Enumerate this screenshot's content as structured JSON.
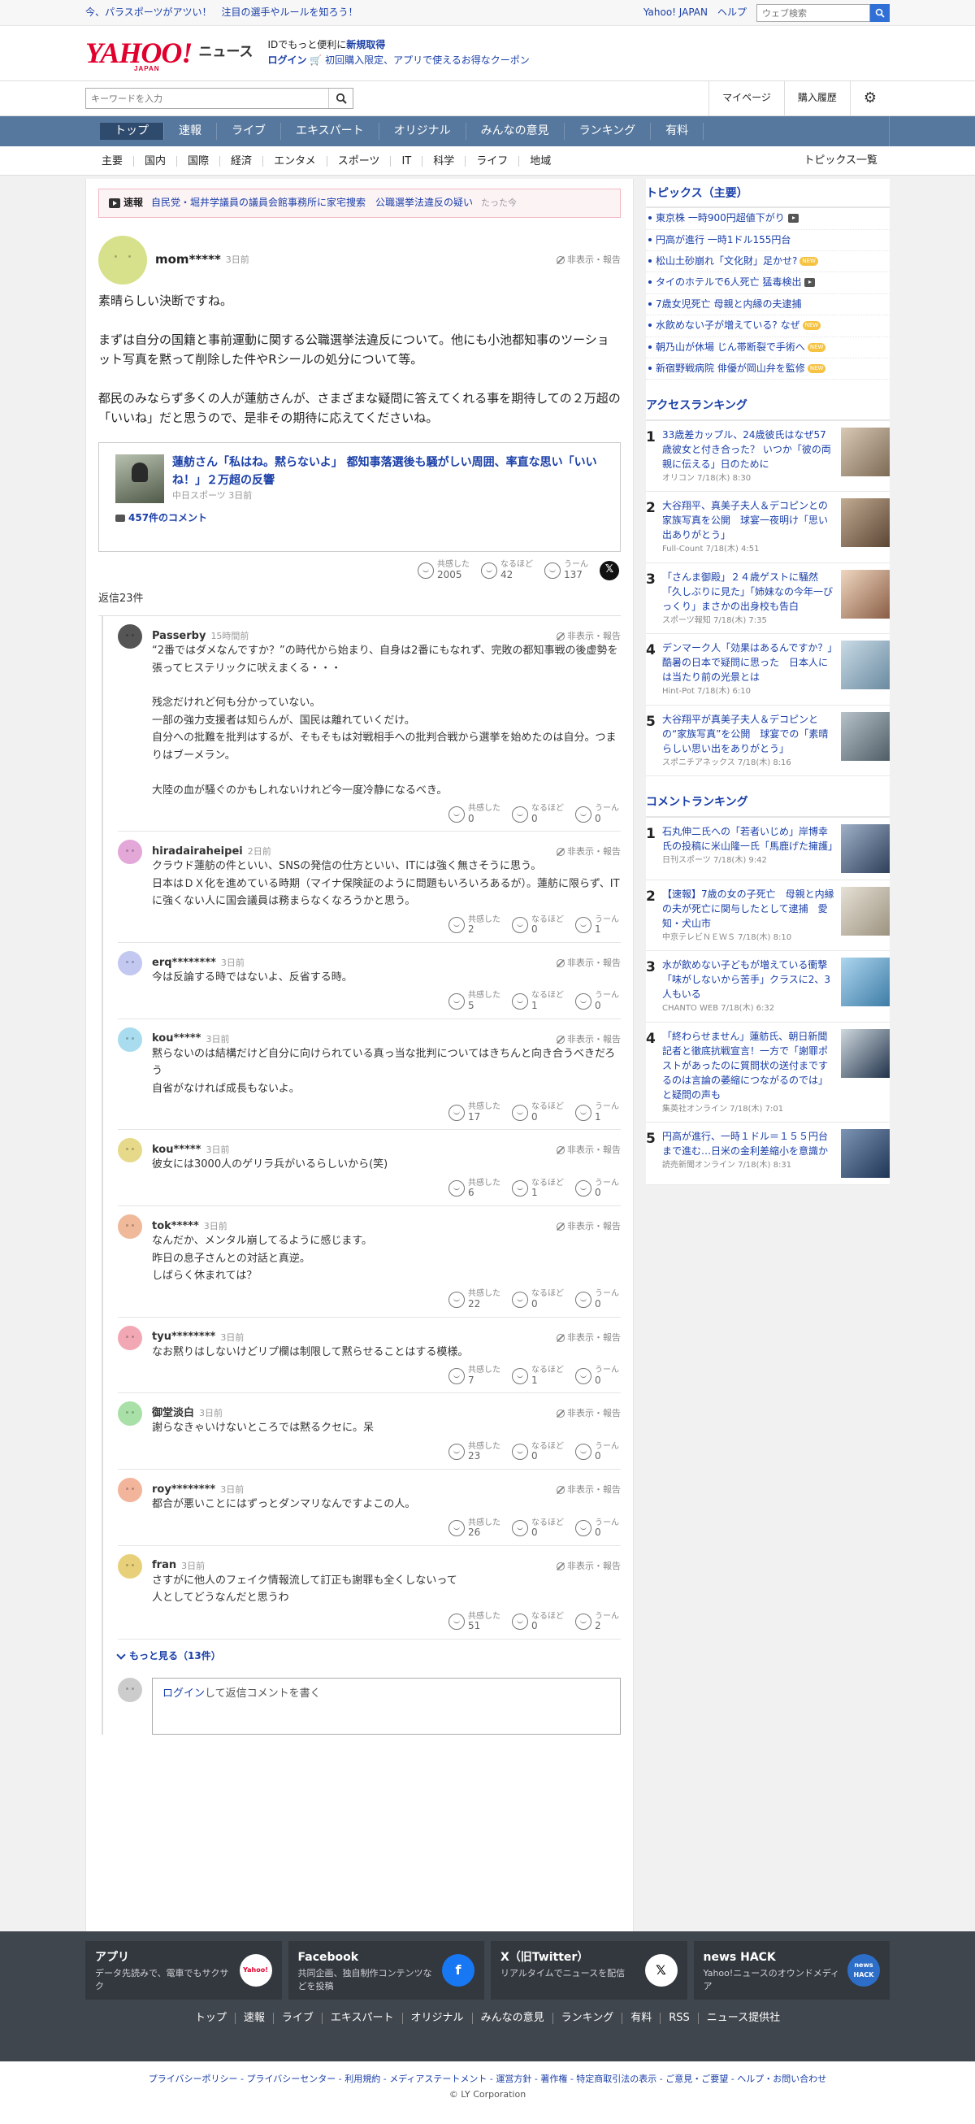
{
  "topbar": {
    "promo": "今、パラスポーツがアツい！　注目の選手やルールを知ろう！",
    "yj": "Yahoo! JAPAN",
    "help": "ヘルプ",
    "web_search_placeholder": "ウェブ検索"
  },
  "header": {
    "logo": "YAHOO!",
    "logo_sub": "JAPAN",
    "news": "ニュース",
    "id_line_1": "IDでもっと便利に",
    "id_line_1b": "新規取得",
    "login": "ログイン",
    "coupon": "初回購入限定、アプリで使えるお得なクーポン"
  },
  "search": {
    "placeholder": "キーワードを入力",
    "mypage": "マイページ",
    "history": "購入履歴"
  },
  "gnav": [
    "トップ",
    "速報",
    "ライブ",
    "エキスパート",
    "オリジナル",
    "みんなの意見",
    "ランキング",
    "有料"
  ],
  "snav": [
    "主要",
    "国内",
    "国際",
    "経済",
    "エンタメ",
    "スポーツ",
    "IT",
    "科学",
    "ライフ",
    "地域"
  ],
  "snav_all": "トピックス一覧",
  "breaking": {
    "tag": "速報",
    "text": "自民党・堀井学議員の議員会館事務所に家宅捜索　公職選挙法違反の疑い",
    "time": "たった今"
  },
  "post": {
    "user": "mom*****",
    "ago": "3日前",
    "hide": "非表示・報告",
    "text": "素晴らしい決断ですね。\n\nまずは自分の国籍と事前運動に関する公職選挙法違反について。他にも小池都知事のツーショット写真を黙って削除した件やRシールの処分について等。\n\n都民のみならず多くの人が蓮舫さんが、さまざまな疑問に答えてくれる事を期待しての２万超の「いいね」だと思うので、是非その期待に応えてくださいね。",
    "article_title": "蓮舫さん「私はね。黙らないよ」 都知事落選後も騒がしい周囲、率直な思い「いいね！」２万超の反響",
    "article_src": "中日スポーツ 3日前",
    "article_comments": "457件のコメント",
    "react": {
      "l1": "共感した",
      "n1": "2005",
      "l2": "なるほど",
      "n2": "42",
      "l3": "うーん",
      "n3": "137"
    },
    "x": "𝕏"
  },
  "replies_header": "返信23件",
  "replies": [
    {
      "name": "Passerby",
      "ago": "15時間前",
      "color": "#555555",
      "text": "“2番ではダメなんですか？”の時代から始まり、自身は2番にもなれず、完敗の都知事戦の後虚勢を張ってヒステリックに吠えまくる・・・\n\n残念だけれど何も分かっていない。\n一部の強力支援者は知らんが、国民は離れていくだけ。\n自分への批難を批判はするが、そもそもは対戦相手への批判合戦から選挙を始めたのは自分。つまりはブーメラン。\n\n大陸の血が騒ぐのかもしれないけれど今一度冷静になるべき。",
      "n1": "0",
      "n2": "0",
      "n3": "0"
    },
    {
      "name": "hiradairaheipei",
      "ago": "2日前",
      "color": "#e3a8d8",
      "text": "クラウド蓮舫の件といい、SNSの発信の仕方といい、ITには強く無さそうに思う。\n日本はＤＸ化を進めている時期（マイナ保険証のように問題もいろいろあるが）。蓮舫に限らず、ITに強くない人に国会議員は務まらなくなろうかと思う。",
      "n1": "2",
      "n2": "0",
      "n3": "1"
    },
    {
      "name": "erq********",
      "ago": "3日前",
      "color": "#c2c8f0",
      "text": "今は反論する時ではないよ、反省する時。",
      "n1": "5",
      "n2": "1",
      "n3": "0"
    },
    {
      "name": "kou*****",
      "ago": "3日前",
      "color": "#a8dcee",
      "text": "黙らないのは結構だけど自分に向けられている真っ当な批判についてはきちんと向き合うべきだろう\n自省がなければ成長もないよ。",
      "n1": "17",
      "n2": "0",
      "n3": "1"
    },
    {
      "name": "kou*****",
      "ago": "3日前",
      "color": "#e6d98a",
      "text": "彼女には3000人のゲリラ兵がいるらしいから(笑)",
      "n1": "6",
      "n2": "1",
      "n3": "0"
    },
    {
      "name": "tok*****",
      "ago": "3日前",
      "color": "#efb99a",
      "text": "なんだか、メンタル崩してるように感じます。\n昨日の息子さんとの対話と真逆。\nしばらく休まれては？",
      "n1": "22",
      "n2": "0",
      "n3": "0"
    },
    {
      "name": "tyu********",
      "ago": "3日前",
      "color": "#f2a8b4",
      "text": "なお黙りはしないけどリプ欄は制限して黙らせることはする模様。",
      "n1": "7",
      "n2": "1",
      "n3": "0"
    },
    {
      "name": "御堂淡白",
      "ago": "3日前",
      "color": "#a8e0a8",
      "text": "謝らなきゃいけないところでは黙るクセに。呆",
      "n1": "23",
      "n2": "0",
      "n3": "0"
    },
    {
      "name": "roy********",
      "ago": "3日前",
      "color": "#f2b49a",
      "text": "都合が悪いことにはずっとダンマリなんですよこの人。",
      "n1": "26",
      "n2": "0",
      "n3": "0"
    },
    {
      "name": "fran",
      "ago": "3日前",
      "color": "#e8d07a",
      "text": "さすがに他人のフェイク情報流して訂正も謝罪も全くしないって\n人としてどうなんだと思うわ",
      "n1": "51",
      "n2": "0",
      "n3": "2"
    }
  ],
  "react_labels": {
    "l1": "共感した",
    "l2": "なるほど",
    "l3": "うーん"
  },
  "more": "もっと見る（13件）",
  "replybox": {
    "login": "ログイン",
    "rest": "して返信コメントを書く"
  },
  "topics": {
    "title": "トピックス（主要）",
    "items": [
      {
        "t": "東京株 一時900円超値下がり",
        "badge": "video"
      },
      {
        "t": "円高が進行 一時1ドル155円台",
        "badge": ""
      },
      {
        "t": "松山土砂崩れ「文化財」足かせ?",
        "badge": "NEW"
      },
      {
        "t": "タイのホテルで6人死亡 猛毒検出",
        "badge": "video"
      },
      {
        "t": "7歳女児死亡 母親と内縁の夫逮捕",
        "badge": ""
      },
      {
        "t": "水飲めない子が増えている? なぜ",
        "badge": "NEW"
      },
      {
        "t": "朝乃山が休場 じん帯断裂で手術へ",
        "badge": "NEW"
      },
      {
        "t": "新宿野戦病院 俳優が岡山弁を監修",
        "badge": "NEW"
      }
    ]
  },
  "access": {
    "title": "アクセスランキング",
    "items": [
      {
        "n": "1",
        "t": "33歳差カップル、24歳彼氏はなぜ57歳彼女と付き合った？ いつか「彼の両親に伝える」日のために",
        "s": "オリコン 7/18(木) 8:30"
      },
      {
        "n": "2",
        "t": "大谷翔平、真美子夫人＆デコピンとの家族写真を公開　球宴一夜明け「思い出ありがとう」",
        "s": "Full-Count 7/18(木) 4:51"
      },
      {
        "n": "3",
        "t": "「さんま御殿」２４歳ゲストに騒然「久しぶりに見た」「姉妹なの今年一びっくり」まさかの出身校も告白",
        "s": "スポーツ報知 7/18(木) 7:35"
      },
      {
        "n": "4",
        "t": "デンマーク人「効果はあるんですか？」　酷暑の日本で疑問に思った　日本人には当たり前の光景とは",
        "s": "Hint-Pot 7/18(木) 6:10"
      },
      {
        "n": "5",
        "t": "大谷翔平が真美子夫人＆デコピンとの“家族写真”を公開　球宴での「素晴らしい思い出をありがとう」",
        "s": "スポニチアネックス 7/18(木) 8:16"
      }
    ]
  },
  "comment_rank": {
    "title": "コメントランキング",
    "items": [
      {
        "n": "1",
        "t": "石丸伸二氏への「若者いじめ」岸博幸氏の投稿に米山隆一氏「馬鹿げた擁護」",
        "s": "日刊スポーツ 7/18(木) 9:42"
      },
      {
        "n": "2",
        "t": "【速報】7歳の女の子死亡　母親と内縁の夫が死亡に関与したとして逮捕　愛知・犬山市",
        "s": "中京テレビＮＥＷＳ 7/18(木) 8:10"
      },
      {
        "n": "3",
        "t": "水が飲めない子どもが増えている衝撃「味がしないから苦手」クラスに2、3人もいる",
        "s": "CHANTO WEB 7/18(木) 6:32"
      },
      {
        "n": "4",
        "t": "「終わらせません」蓮舫氏、朝日新聞記者と徹底抗戦宣言！一方で「謝罪ポストがあったのに質問状の送付までするのは言論の萎縮につながるのでは」と疑問の声も",
        "s": "集英社オンライン 7/18(木) 7:01"
      },
      {
        "n": "5",
        "t": "円高が進行、一時１ドル＝１５５円台まで進む…日米の金利差縮小を意識か",
        "s": "読売新聞オンライン 7/18(木) 8:31"
      }
    ]
  },
  "footer": {
    "cards": [
      {
        "t": "アプリ",
        "d": "データ先読みで、電車でもサクサク",
        "icon": "Yahoo!"
      },
      {
        "t": "Facebook",
        "d": "共同企画、独自制作コンテンツなどを投稿",
        "icon": "f"
      },
      {
        "t": "X（旧Twitter）",
        "d": "リアルタイムでニュースを配信",
        "icon": "𝕏"
      },
      {
        "t": "news HACK",
        "d": "Yahoo!ニュースのオウンドメディア",
        "icon": "news HACK"
      }
    ],
    "links": [
      "トップ",
      "速報",
      "ライブ",
      "エキスパート",
      "オリジナル",
      "みんなの意見",
      "ランキング",
      "有料",
      "RSS",
      "ニュース提供社"
    ]
  },
  "bottom": {
    "links": "プライバシーポリシー - プライバシーセンター - 利用規約 - メディアステートメント - 運営方針 - 著作権 - 特定商取引法の表示 - ご意見・ご要望 - ヘルプ・お問い合わせ",
    "copy": "© LY Corporation"
  }
}
